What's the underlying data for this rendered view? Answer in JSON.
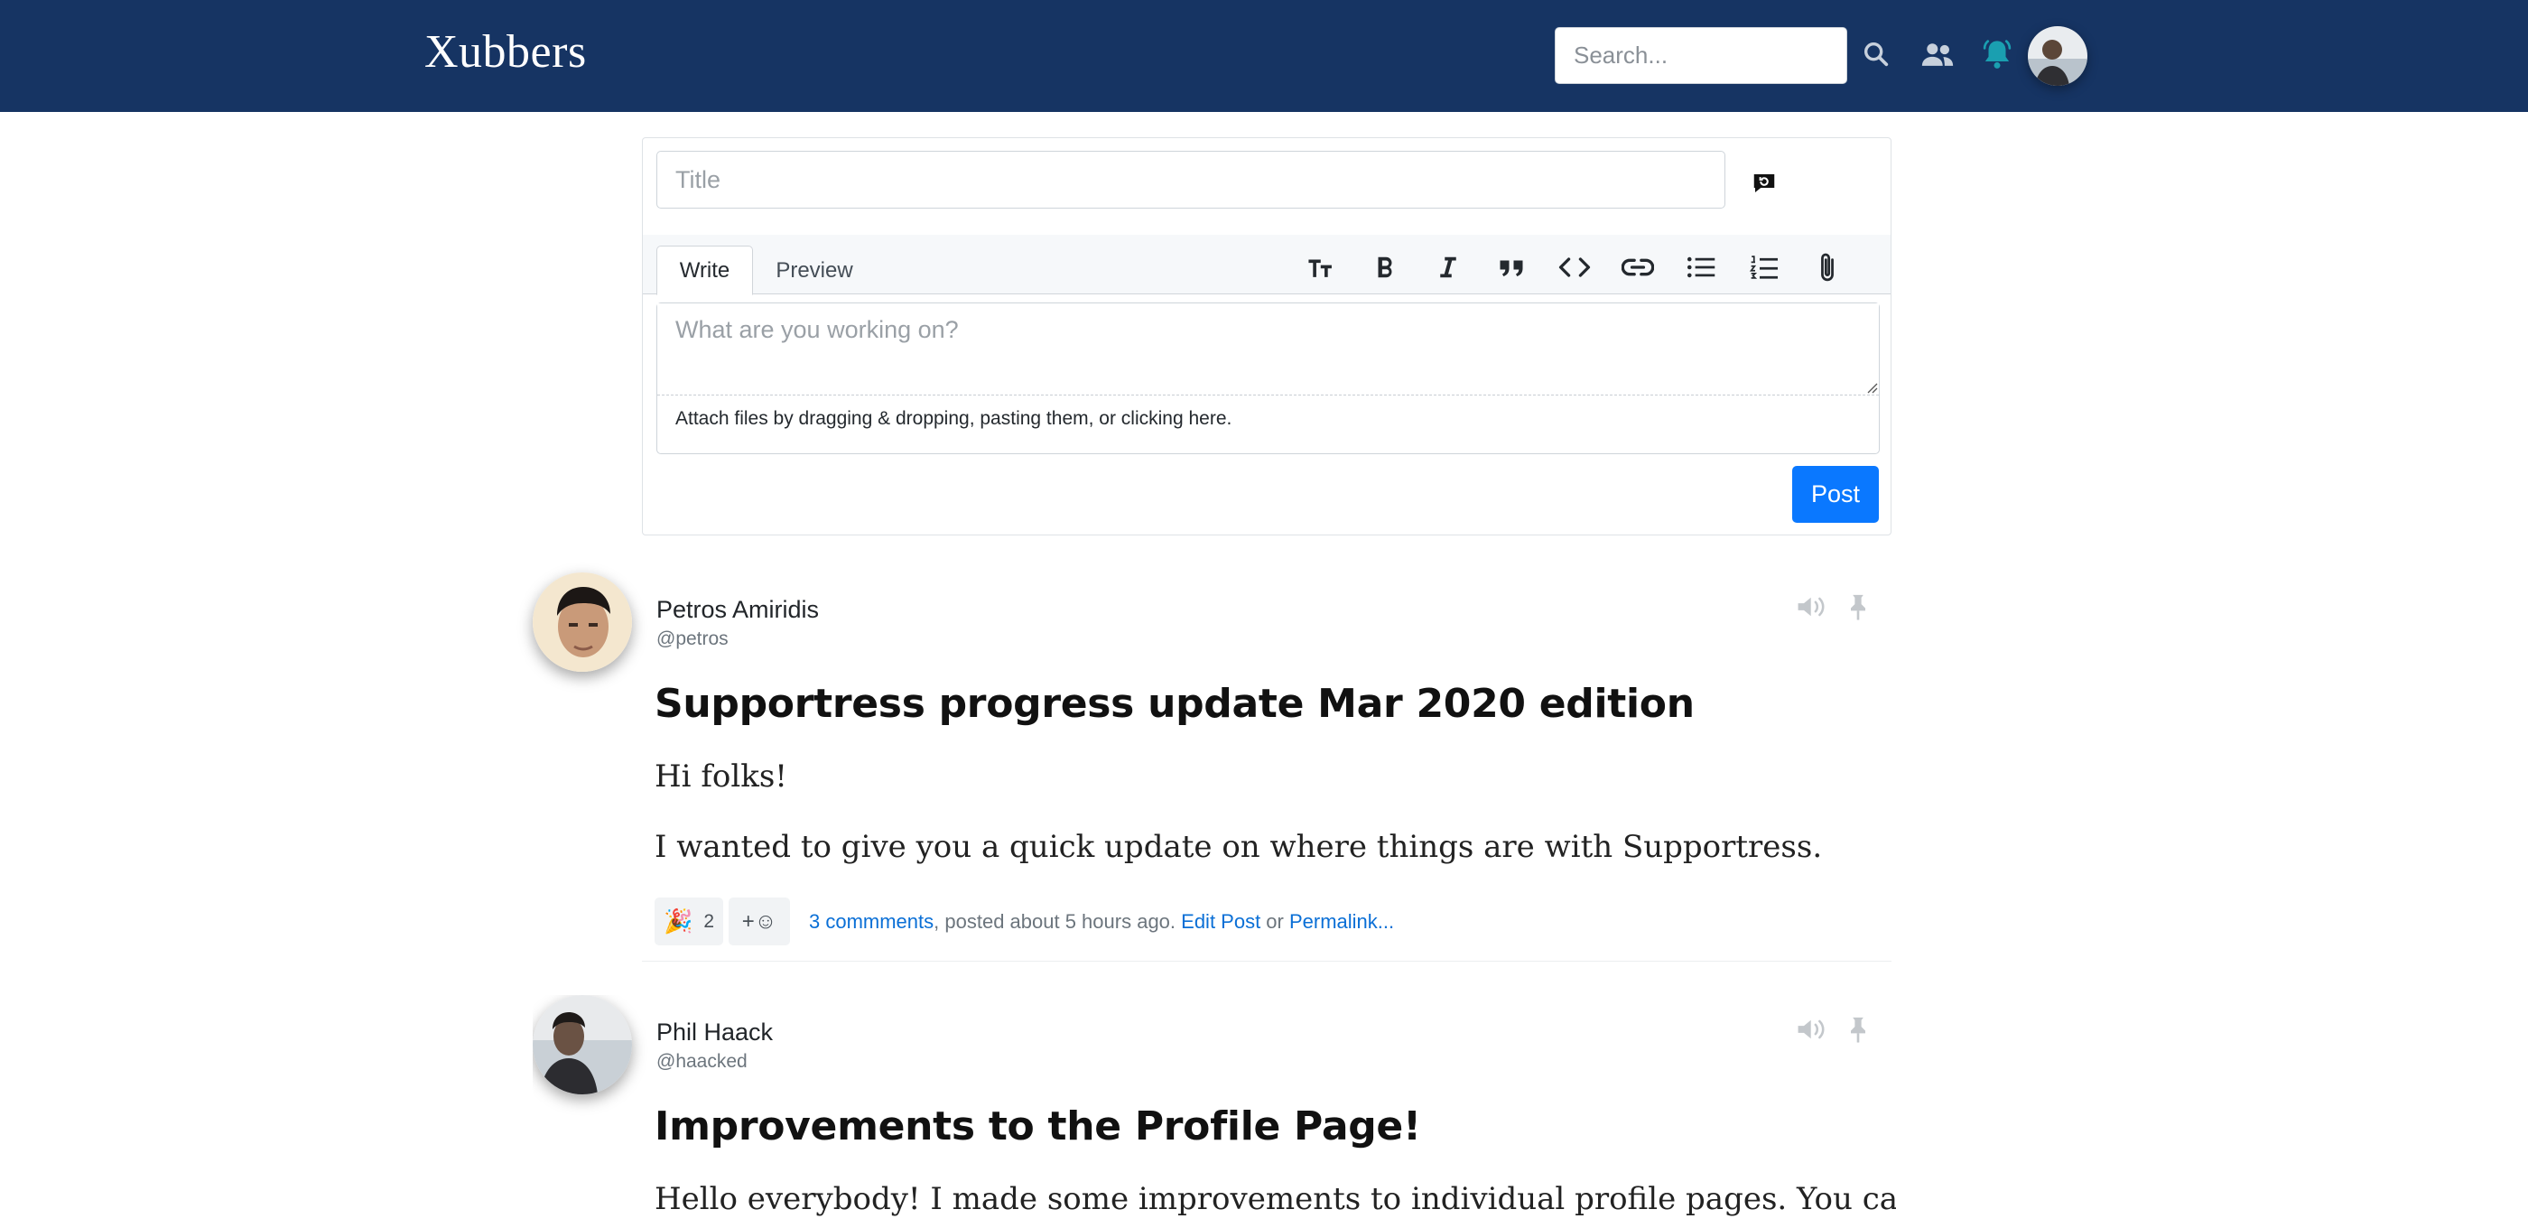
{
  "header": {
    "brand": "Xubbers",
    "search_placeholder": "Search...",
    "icons": [
      "search-icon",
      "people-icon",
      "notification-bell-icon"
    ],
    "bell_color": "#1a9fb0",
    "background": "#163463"
  },
  "composer": {
    "title_placeholder": "Title",
    "tabs": [
      {
        "label": "Write",
        "active": true
      },
      {
        "label": "Preview",
        "active": false
      }
    ],
    "toolbar_icons": [
      "text-size-icon",
      "bold-icon",
      "italic-icon",
      "quote-icon",
      "code-icon",
      "link-icon",
      "bulleted-list-icon",
      "numbered-list-icon",
      "paperclip-icon"
    ],
    "body_placeholder": "What are you working on?",
    "attach_hint": "Attach files by dragging & dropping, pasting them, or clicking here.",
    "post_label": "Post",
    "accent": "#0a78ff"
  },
  "posts": [
    {
      "author": "Petros Amiridis",
      "handle": "@petros",
      "title": "Supportress progress update Mar 2020 edition",
      "paragraphs": [
        "Hi folks!",
        "I wanted to give you a quick update on where things are with Supportress."
      ],
      "reaction_emoji": "🎉",
      "reaction_count": "2",
      "add_reaction": "+☺",
      "comments": "3 commments",
      "posted": ", posted about 5 hours ago. ",
      "edit": "Edit Post",
      "or": " or ",
      "permalink": "Permalink..."
    },
    {
      "author": "Phil Haack",
      "handle": "@haacked",
      "title": "Improvements to the Profile Page!",
      "paragraphs": [
        "Hello everybody! I made some improvements to individual profile pages. You can"
      ]
    }
  ]
}
